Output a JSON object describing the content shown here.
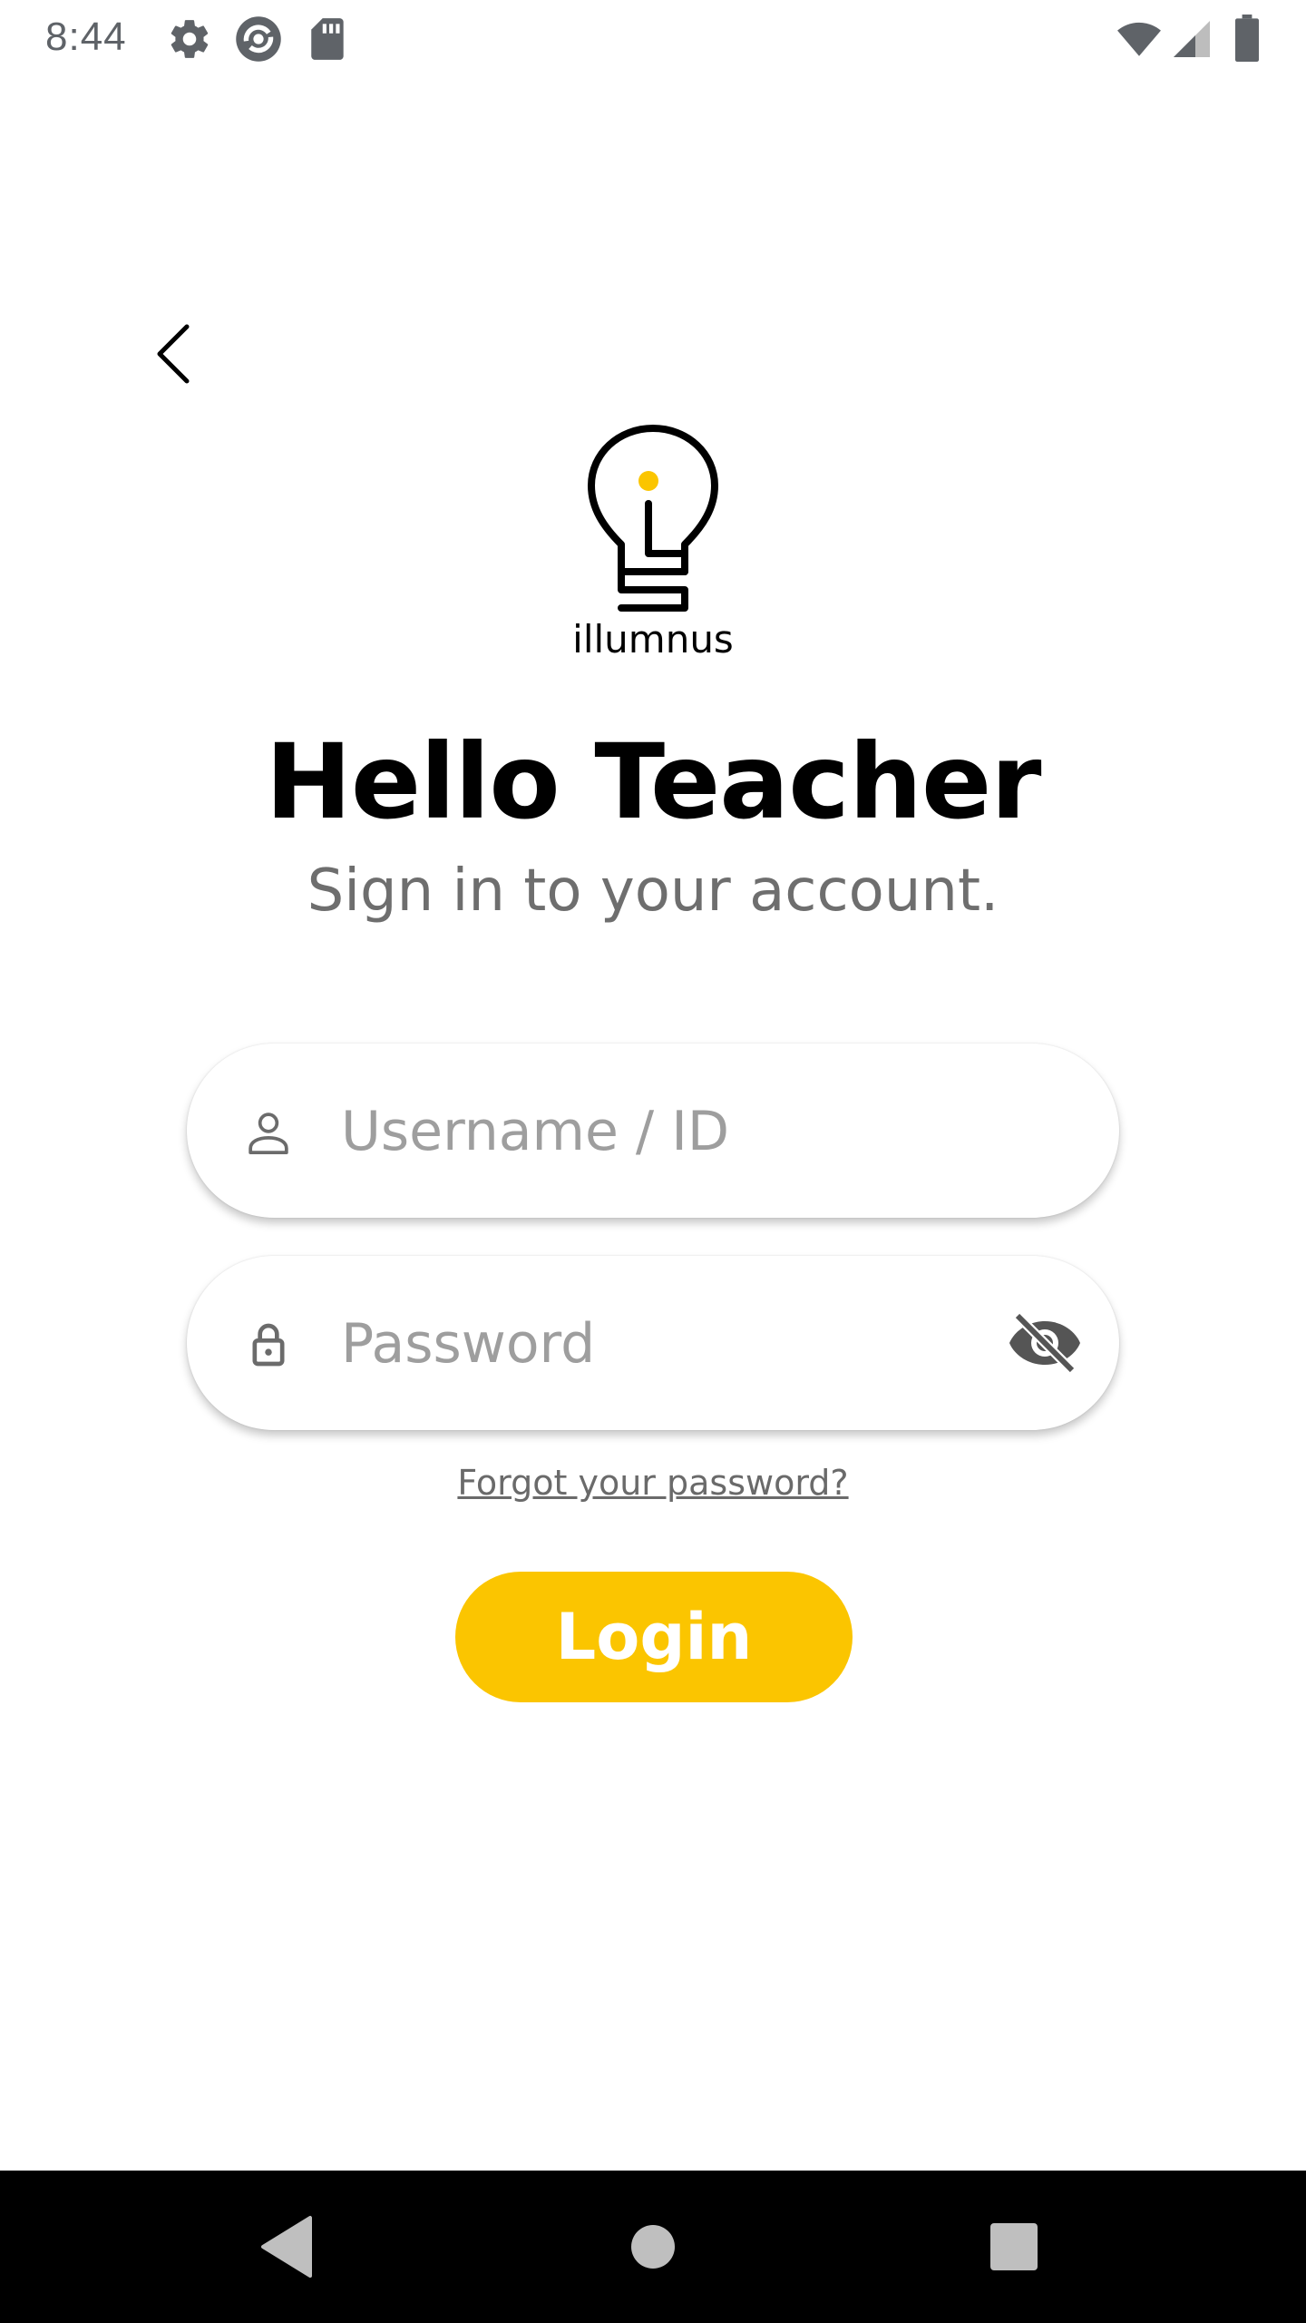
{
  "status_bar": {
    "time": "8:44",
    "icons": [
      "settings-icon",
      "sync-app-icon",
      "sd-card-icon",
      "wifi-icon",
      "cellular-signal-icon",
      "battery-icon"
    ]
  },
  "header": {
    "back_icon": "chevron-left-icon"
  },
  "logo": {
    "icon": "lightbulb-icon",
    "text": "illumnus",
    "accent_color": "#fbc500"
  },
  "title": "Hello Teacher",
  "subtitle": "Sign in to your account.",
  "form": {
    "username": {
      "icon": "person-icon",
      "placeholder": "Username / ID",
      "value": ""
    },
    "password": {
      "icon": "lock-icon",
      "placeholder": "Password",
      "value": "",
      "toggle_icon": "eye-off-icon"
    },
    "forgot_label": "Forgot your password?",
    "login_label": "Login"
  },
  "colors": {
    "accent": "#fbc500",
    "subtitle": "#6e6e6e",
    "placeholder": "#9e9e9e"
  },
  "nav_bar": {
    "icons": [
      "back-triangle-icon",
      "home-circle-icon",
      "recents-square-icon"
    ]
  }
}
